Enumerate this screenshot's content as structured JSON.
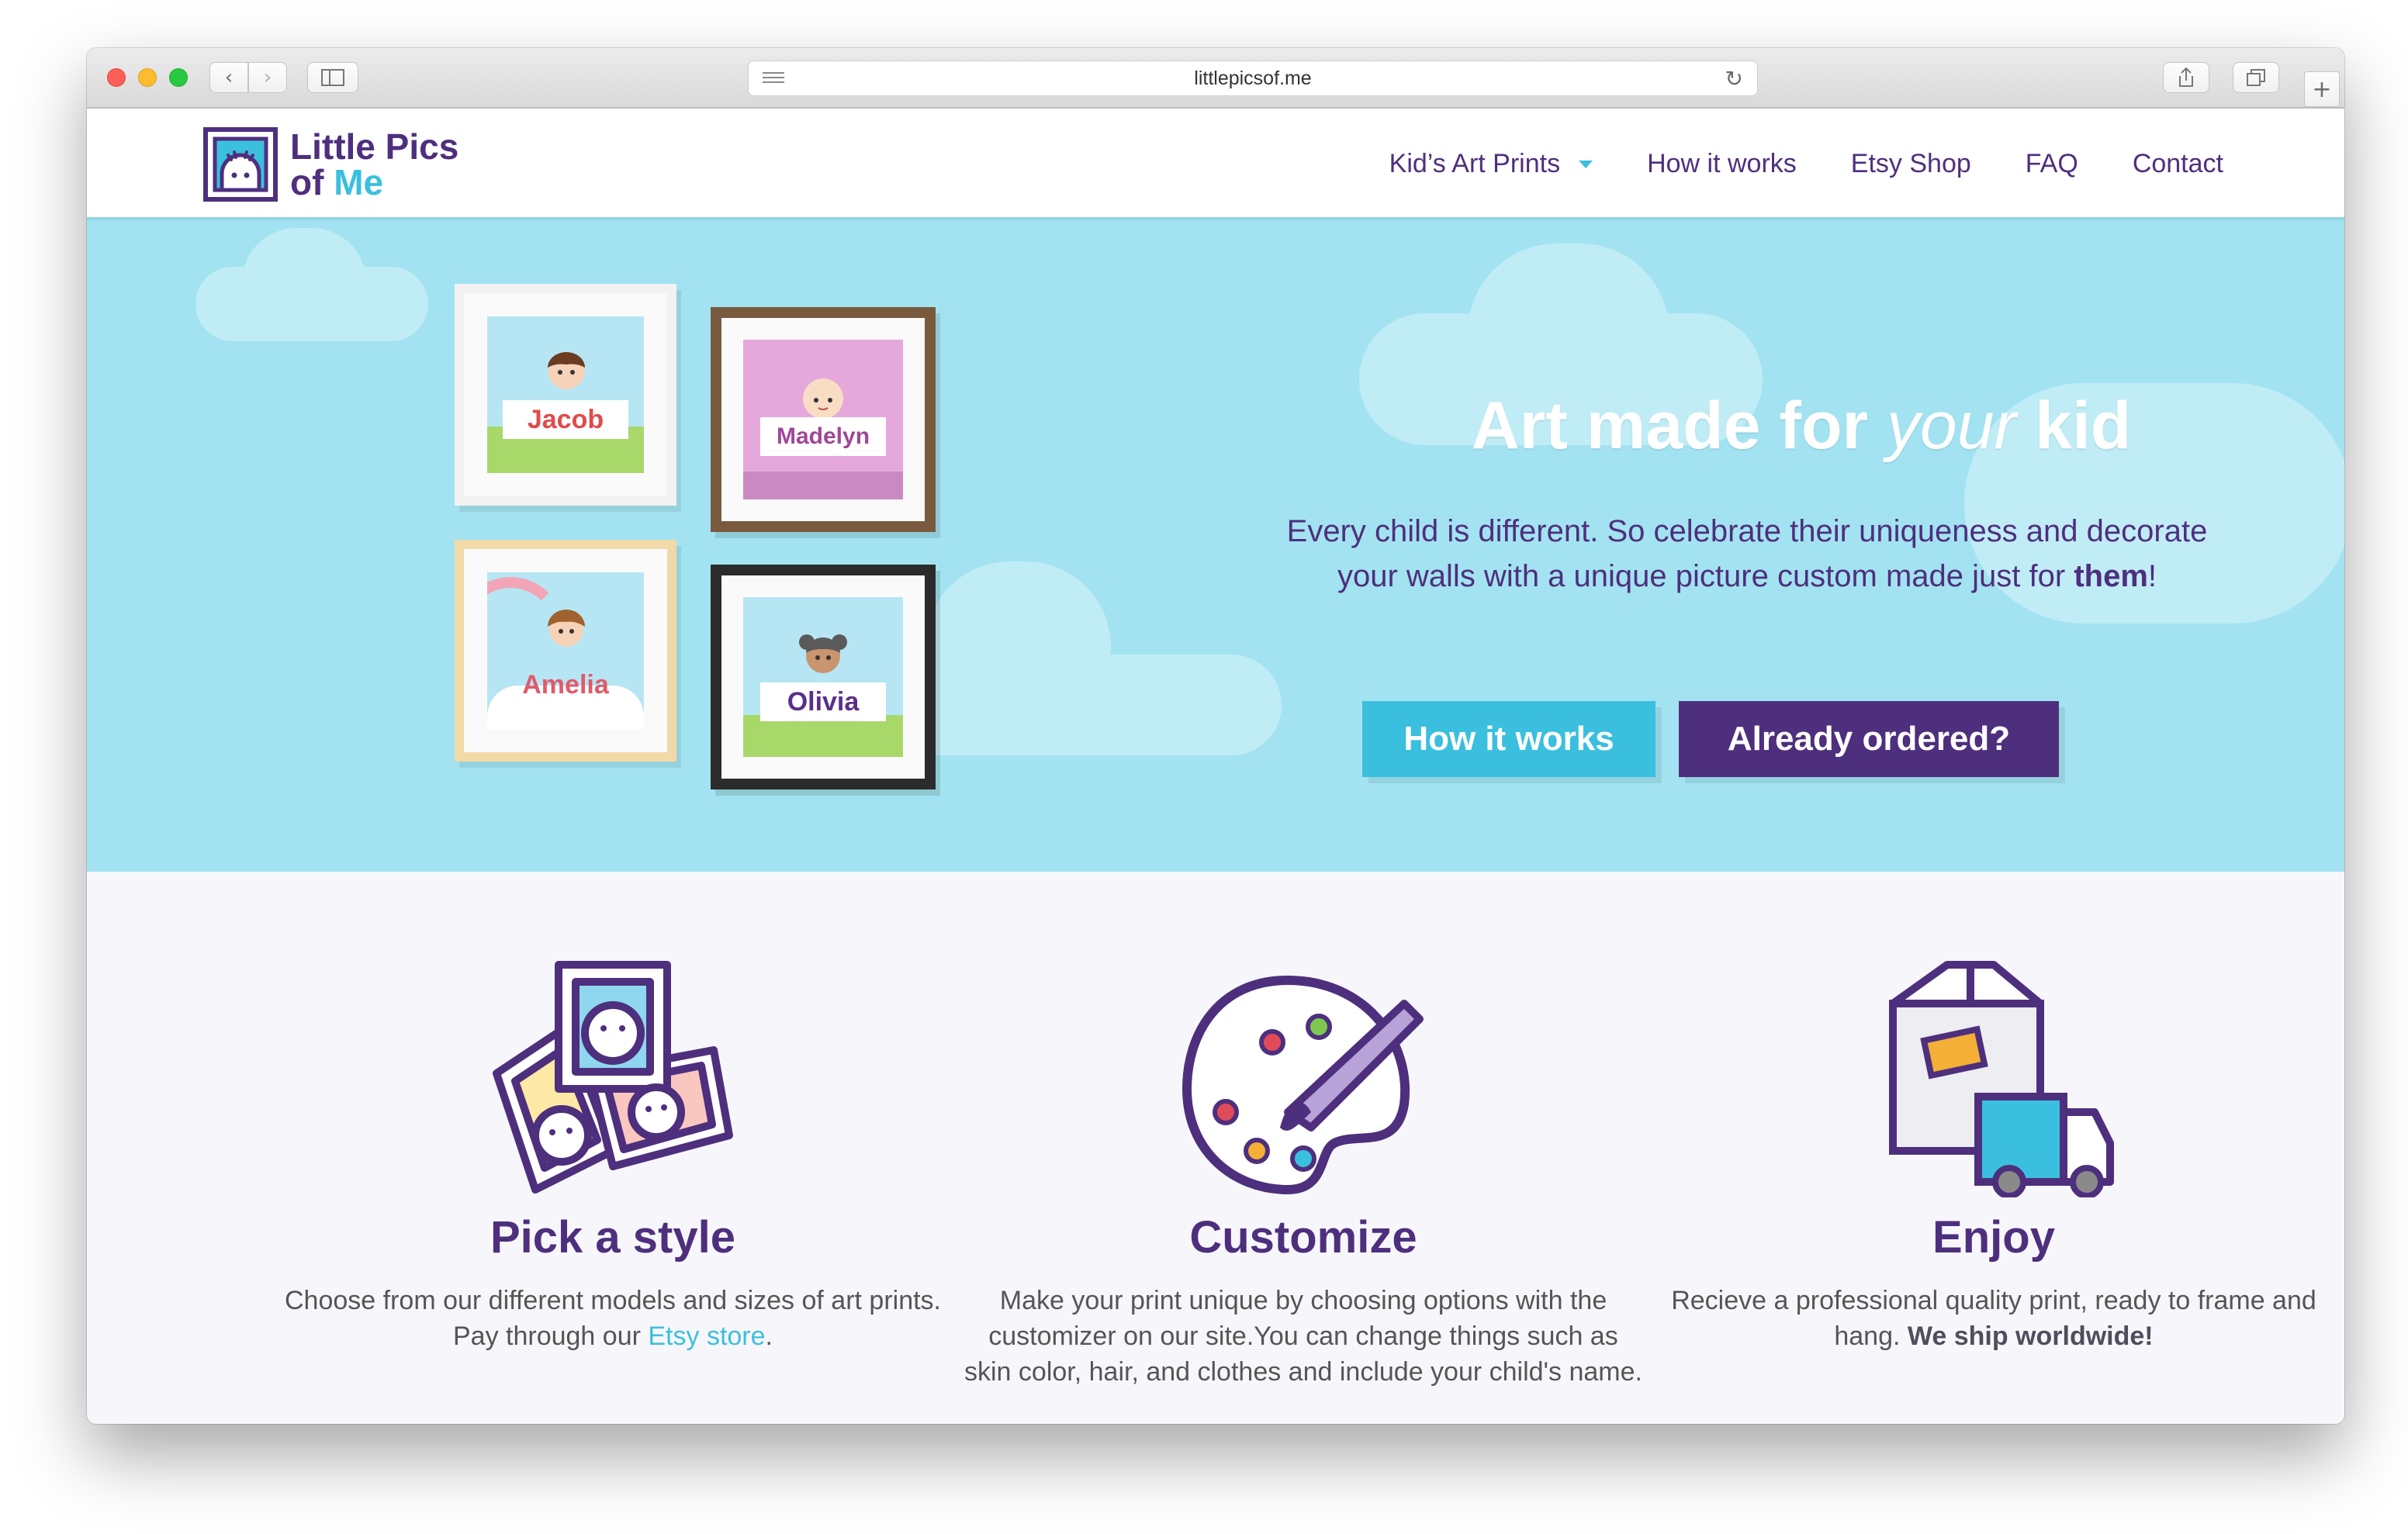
{
  "browser": {
    "url": "littlepicsof.me"
  },
  "site": {
    "logo": {
      "line1": "Little Pics",
      "line2_of": "of",
      "line2_me": "Me"
    },
    "nav": [
      {
        "label": "Kid’s Art Prints",
        "has_dropdown": true
      },
      {
        "label": "How it works"
      },
      {
        "label": "Etsy Shop"
      },
      {
        "label": "FAQ"
      },
      {
        "label": "Contact"
      }
    ]
  },
  "hero": {
    "title_part1": "Art made for ",
    "title_em": "your",
    "title_part2": " kid",
    "subtitle_main": "Every child is different. So celebrate their uniqueness and decorate your walls with a unique picture custom made just for ",
    "subtitle_strong": "them",
    "subtitle_end": "!",
    "btn_how": "How it works",
    "btn_ordered": "Already ordered?",
    "frames": [
      {
        "name": "Jacob",
        "color": "#e04b4b"
      },
      {
        "name": "Madelyn",
        "color": "#a0469a"
      },
      {
        "name": "Amelia",
        "color": "#e05a6a"
      },
      {
        "name": "Olivia",
        "color": "#5a2f8a"
      }
    ]
  },
  "features": [
    {
      "title": "Pick a style",
      "text_before": "Choose from our different models and sizes of art prints. Pay through our ",
      "link": "Etsy store",
      "text_after": "."
    },
    {
      "title": "Customize",
      "text": "Make your print unique by choosing options with the customizer on our site.You can change things such as skin color, hair, and clothes and include your child's name."
    },
    {
      "title": "Enjoy",
      "text_before": "Recieve a professional quality print, ready to frame and hang. ",
      "strong": "We ship worldwide!"
    }
  ],
  "colors": {
    "brand_purple": "#4e2f7d",
    "brand_cyan": "#3bbfde",
    "hero_bg": "#a3e3f1"
  }
}
